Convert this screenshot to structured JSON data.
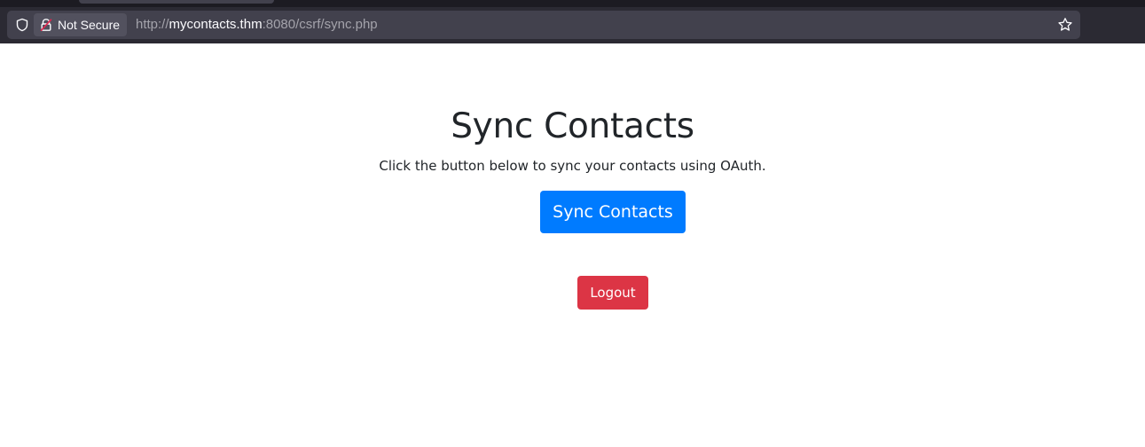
{
  "browser": {
    "security_label": "Not Secure",
    "url": {
      "scheme": "http://",
      "host": "mycontacts.thm",
      "rest": ":8080/csrf/sync.php"
    }
  },
  "page": {
    "title": "Sync Contacts",
    "description": "Click the button below to sync your contacts using OAuth.",
    "sync_button": "Sync Contacts",
    "logout_button": "Logout"
  },
  "colors": {
    "primary": "#007bff",
    "danger": "#dc3545",
    "text": "#212529"
  }
}
